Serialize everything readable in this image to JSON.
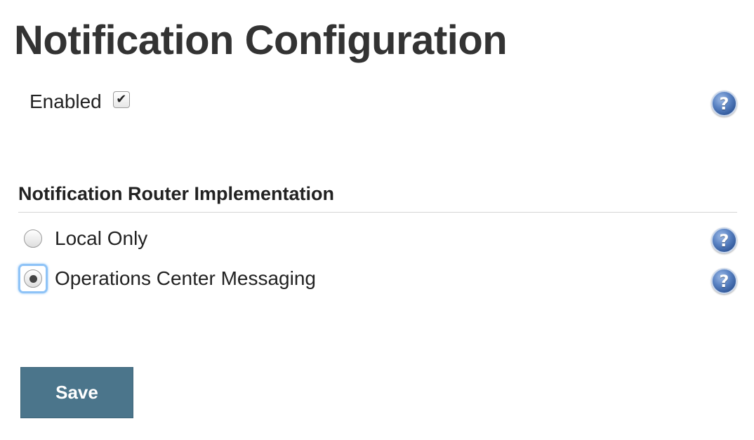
{
  "page": {
    "title": "Notification Configuration"
  },
  "enabled": {
    "label": "Enabled",
    "checked": true,
    "check_glyph": "✔"
  },
  "router": {
    "header": "Notification Router Implementation",
    "options": [
      {
        "label": "Local Only",
        "selected": false
      },
      {
        "label": "Operations Center Messaging",
        "selected": true
      }
    ]
  },
  "help": {
    "glyph": "?"
  },
  "actions": {
    "save_label": "Save"
  },
  "colors": {
    "save_button": "#4b758b",
    "focus_ring": "#8ec3f7",
    "help_icon": "#2e5597"
  }
}
